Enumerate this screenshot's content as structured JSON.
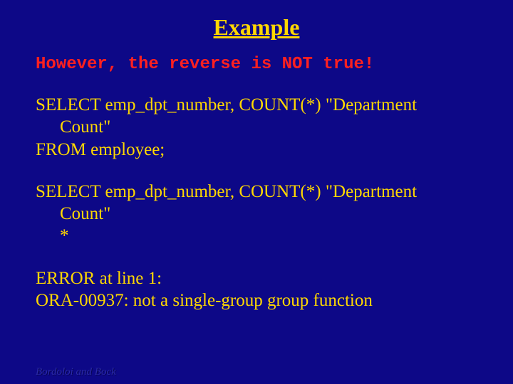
{
  "title": "Example",
  "warning": "However, the reverse is NOT true!",
  "query": {
    "line1": "SELECT emp_dpt_number, COUNT(*) \"Department",
    "line2": "Count\"",
    "line3": "FROM employee;"
  },
  "echo": {
    "line1": "SELECT emp_dpt_number, COUNT(*) \"Department",
    "line2": "Count\"",
    "marker": "*"
  },
  "error": {
    "line1": "ERROR at line 1:",
    "line2": "ORA-00937: not a single-group group function"
  },
  "footer": "Bordoloi and Bock"
}
